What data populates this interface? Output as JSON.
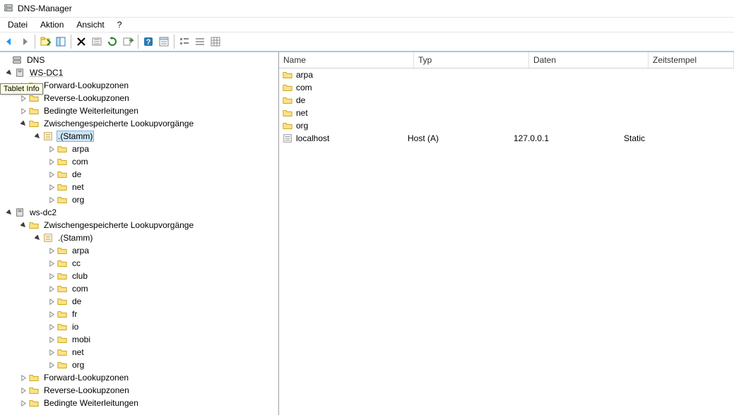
{
  "title": "DNS-Manager",
  "tooltip": "Tablet Info",
  "menu": {
    "datei": "Datei",
    "aktion": "Aktion",
    "ansicht": "Ansicht",
    "help": "?"
  },
  "toolbar_icons": {
    "back": "back-icon",
    "forward": "forward-icon",
    "up": "up-icon",
    "show": "show-icon",
    "delete": "delete-icon",
    "refresh": "refresh-icon",
    "reload": "reload-icon",
    "export": "export-icon",
    "help": "help-icon",
    "props": "props-icon",
    "list1": "list1-icon",
    "list2": "list2-icon",
    "list3": "list3-icon"
  },
  "tree": {
    "root": "DNS",
    "server1": {
      "name": "WS-DC1",
      "fwd": "Forward-Lookupzonen",
      "rev": "Reverse-Lookupzonen",
      "cond": "Bedingte Weiterleitungen",
      "cache": "Zwischengespeicherte Lookupvorgänge",
      "stamm": ".(Stamm)",
      "zones": [
        "arpa",
        "com",
        "de",
        "net",
        "org"
      ]
    },
    "server2": {
      "name": "ws-dc2",
      "cache": "Zwischengespeicherte Lookupvorgänge",
      "stamm": ".(Stamm)",
      "zones": [
        "arpa",
        "cc",
        "club",
        "com",
        "de",
        "fr",
        "io",
        "mobi",
        "net",
        "org"
      ],
      "fwd": "Forward-Lookupzonen",
      "rev": "Reverse-Lookupzonen",
      "cond": "Bedingte Weiterleitungen"
    }
  },
  "list": {
    "headers": {
      "name": "Name",
      "typ": "Typ",
      "daten": "Daten",
      "zeit": "Zeitstempel"
    },
    "folders": [
      "arpa",
      "com",
      "de",
      "net",
      "org"
    ],
    "records": [
      {
        "name": "localhost",
        "typ": "Host (A)",
        "daten": "127.0.0.1",
        "zeit": "Static"
      }
    ]
  }
}
